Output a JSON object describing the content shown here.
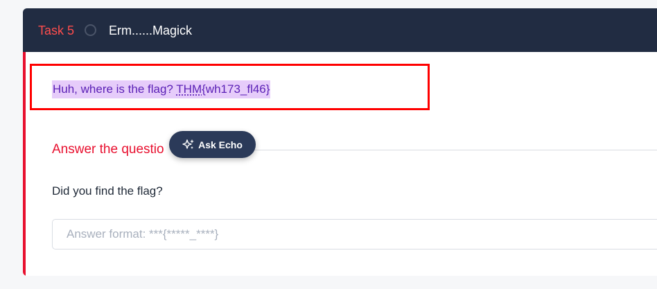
{
  "task": {
    "label": "Task 5",
    "title": "Erm......Magick"
  },
  "content": {
    "text_before": "Huh, where is the flag? ",
    "abbr": "THM",
    "text_after": "{wh173_fl46}"
  },
  "answer_section": {
    "heading": "Answer the questio",
    "question": "Did you find the flag?",
    "placeholder": "Answer format: ***{*****_****}",
    "value": ""
  },
  "ask_echo": {
    "label": "Ask Echo",
    "icon": "sparkles-icon"
  },
  "colors": {
    "header_bg": "#212c42",
    "task_label": "#ff4d4d",
    "accent": "#e8102f",
    "highlight_bg": "#e6ccfa",
    "highlight_text": "#5b21b6",
    "annotation_box": "#ff0000",
    "button_bg": "#2b3a59"
  }
}
